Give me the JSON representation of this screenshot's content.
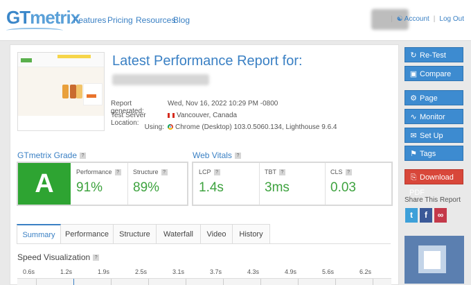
{
  "header": {
    "logo_gt": "GT",
    "logo_metrix": "metrix",
    "nav": [
      "Features",
      "Pricing",
      "Resources",
      "Blog"
    ],
    "account_label": "Account",
    "logout_label": "Log Out"
  },
  "report": {
    "title": "Latest Performance Report for:",
    "generated_label": "Report generated:",
    "generated_value": "Wed, Nov 16, 2022 10:29 PM -0800",
    "location_label": "Test Server Location:",
    "location_value": "Vancouver, Canada",
    "using_label": "Using:",
    "using_value": "Chrome (Desktop) 103.0.5060.134, Lighthouse 9.6.4"
  },
  "grade": {
    "title": "GTmetrix Grade",
    "letter": "A",
    "performance_label": "Performance",
    "performance_value": "91%",
    "structure_label": "Structure",
    "structure_value": "89%"
  },
  "vitals": {
    "title": "Web Vitals",
    "lcp_label": "LCP",
    "lcp_value": "1.4s",
    "tbt_label": "TBT",
    "tbt_value": "3ms",
    "cls_label": "CLS",
    "cls_value": "0.03"
  },
  "tabs": [
    "Summary",
    "Performance",
    "Structure",
    "Waterfall",
    "Video",
    "History"
  ],
  "speed": {
    "title": "Speed Visualization",
    "ticks": [
      "0.6s",
      "1.2s",
      "1.9s",
      "2.5s",
      "3.1s",
      "3.7s",
      "4.3s",
      "4.9s",
      "5.6s",
      "6.2s"
    ]
  },
  "sidebar": {
    "buttons": [
      "Re-Test",
      "Compare",
      "Page Settings",
      "Monitor",
      "Set Up Alerts",
      "Tags",
      "Download PDF"
    ],
    "share_title": "Share This Report"
  },
  "colors": {
    "brand_blue": "#3d8bd0",
    "grade_green": "#2ea432",
    "pdf_red": "#d8473a"
  },
  "icons": {
    "retest": "refresh-icon",
    "compare": "compare-icon",
    "settings": "gear-icon",
    "monitor": "pulse-icon",
    "alerts": "bell-icon",
    "tags": "tag-icon",
    "pdf": "pdf-icon",
    "twitter": "twitter-icon",
    "facebook": "facebook-icon",
    "link": "link-icon"
  }
}
